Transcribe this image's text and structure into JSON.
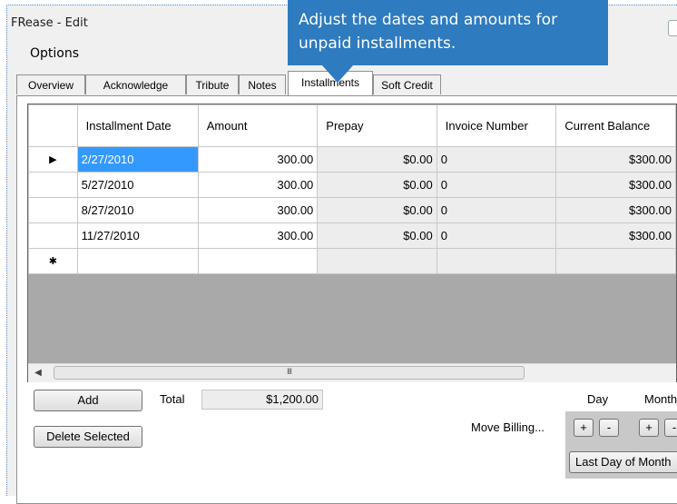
{
  "window": {
    "title": "FRease - Edit"
  },
  "menu": {
    "options": "Options"
  },
  "tabs": [
    {
      "label": "Overview"
    },
    {
      "label": "Acknowledge"
    },
    {
      "label": "Tribute"
    },
    {
      "label": "Notes"
    },
    {
      "label": "Installments",
      "active": true
    },
    {
      "label": "Soft Credit"
    }
  ],
  "callout": {
    "text": "Adjust the dates and amounts for unpaid installments."
  },
  "grid": {
    "columns": [
      "Installment Date",
      "Amount",
      "Prepay",
      "Invoice Number",
      "Current Balance"
    ],
    "rows": [
      {
        "date": "2/27/2010",
        "amount": "300.00",
        "prepay": "$0.00",
        "invoice": "0",
        "balance": "$300.00"
      },
      {
        "date": "5/27/2010",
        "amount": "300.00",
        "prepay": "$0.00",
        "invoice": "0",
        "balance": "$300.00"
      },
      {
        "date": "8/27/2010",
        "amount": "300.00",
        "prepay": "$0.00",
        "invoice": "0",
        "balance": "$300.00"
      },
      {
        "date": "11/27/2010",
        "amount": "300.00",
        "prepay": "$0.00",
        "invoice": "0",
        "balance": "$300.00"
      }
    ],
    "current_row_glyph": "▶",
    "new_row_glyph": "✱",
    "scroll_grip": "III"
  },
  "controls": {
    "add_label": "Add",
    "total_label": "Total",
    "total_value": "$1,200.00",
    "delete_label": "Delete Selected",
    "move_billing_label": "Move Billing...",
    "day_label": "Day",
    "month_label": "Month",
    "plus": "+",
    "minus": "-",
    "last_day_label": "Last Day of Month"
  },
  "colors": {
    "callout": "#2e7bbf",
    "selection": "#3399ff"
  }
}
